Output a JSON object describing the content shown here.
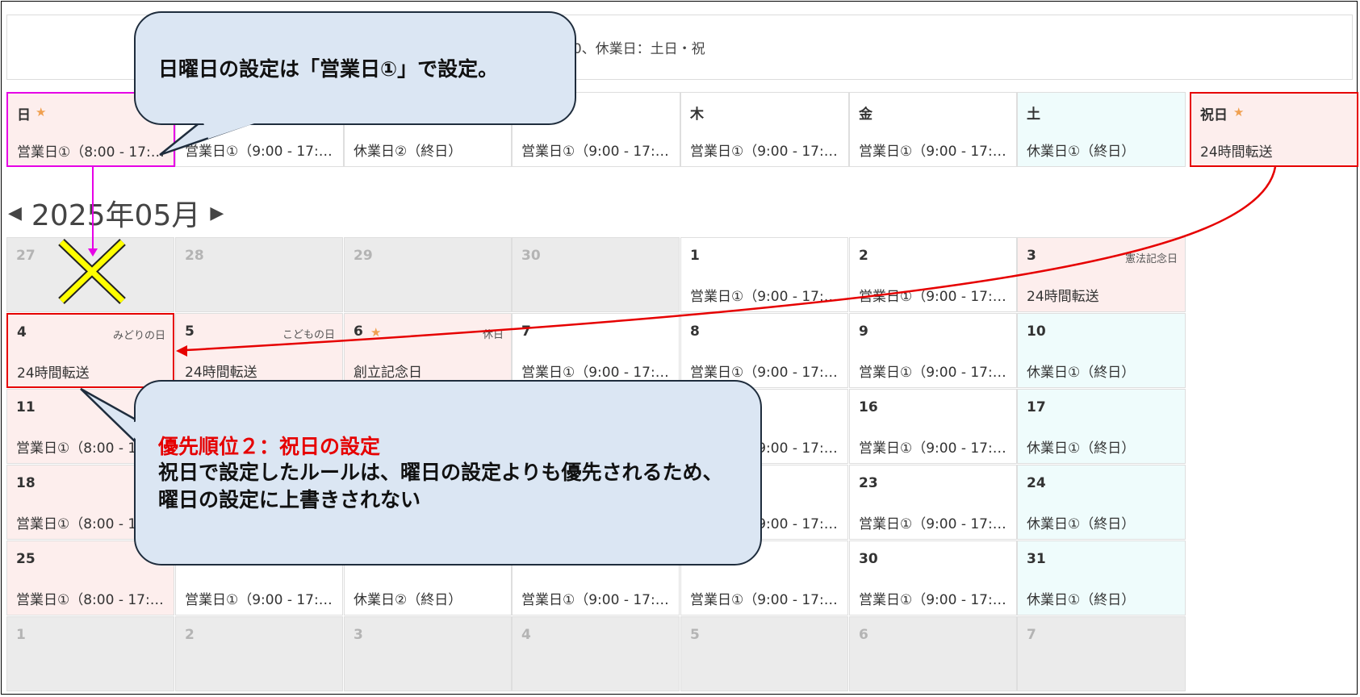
{
  "hours_bar": {
    "text": "00、休業日：土日・祝"
  },
  "weekday_rules": [
    {
      "day": "日",
      "star": true,
      "rule": "営業日①（8:00 - 17:00）",
      "style": "holiday-bg",
      "highlight": "hi-magenta"
    },
    {
      "day": "",
      "star": false,
      "rule": "営業日①（9:00 - 17:00）",
      "style": "",
      "highlight": ""
    },
    {
      "day": "",
      "star": false,
      "rule": "休業日②（終日）",
      "style": "",
      "highlight": ""
    },
    {
      "day": "",
      "star": false,
      "rule": "営業日①（9:00 - 17:00）",
      "style": "",
      "highlight": ""
    },
    {
      "day": "木",
      "star": false,
      "rule": "営業日①（9:00 - 17:00）",
      "style": "",
      "highlight": ""
    },
    {
      "day": "金",
      "star": false,
      "rule": "営業日①（9:00 - 17:00）",
      "style": "",
      "highlight": ""
    },
    {
      "day": "土",
      "star": false,
      "rule": "休業日①（終日）",
      "style": "sat-bg",
      "highlight": ""
    },
    {
      "day": "祝日",
      "star": true,
      "rule": "24時間転送",
      "style": "holiday-bg",
      "highlight": "hi-red"
    }
  ],
  "month_nav": {
    "title": "2025年05月",
    "prev_icon": "◀",
    "next_icon": "▶"
  },
  "calendar_weeks": [
    [
      {
        "day": "27",
        "holiday": "",
        "rule": "",
        "style": "other",
        "star": false
      },
      {
        "day": "28",
        "holiday": "",
        "rule": "",
        "style": "other",
        "star": false
      },
      {
        "day": "29",
        "holiday": "",
        "rule": "",
        "style": "other",
        "star": false
      },
      {
        "day": "30",
        "holiday": "",
        "rule": "",
        "style": "other",
        "star": false
      },
      {
        "day": "1",
        "holiday": "",
        "rule": "営業日①（9:00 - 17:00）",
        "style": "",
        "star": false
      },
      {
        "day": "2",
        "holiday": "",
        "rule": "営業日①（9:00 - 17:00）",
        "style": "",
        "star": false
      },
      {
        "day": "3",
        "holiday": "憲法記念日",
        "rule": "24時間転送",
        "style": "holiday-bg",
        "star": false
      }
    ],
    [
      {
        "day": "4",
        "holiday": "みどりの日",
        "rule": "24時間転送",
        "style": "holiday-bg hi-red",
        "star": false
      },
      {
        "day": "5",
        "holiday": "こどもの日",
        "rule": "24時間転送",
        "style": "holiday-bg",
        "star": false
      },
      {
        "day": "6",
        "holiday": "休日",
        "rule": "創立記念日",
        "style": "holiday-bg",
        "star": true
      },
      {
        "day": "7",
        "holiday": "",
        "rule": "営業日①（9:00 - 17:00）",
        "style": "",
        "star": false
      },
      {
        "day": "8",
        "holiday": "",
        "rule": "営業日①（9:00 - 17:00）",
        "style": "",
        "star": false
      },
      {
        "day": "9",
        "holiday": "",
        "rule": "営業日①（9:00 - 17:00）",
        "style": "",
        "star": false
      },
      {
        "day": "10",
        "holiday": "",
        "rule": "休業日①（終日）",
        "style": "sat-bg",
        "star": false
      }
    ],
    [
      {
        "day": "11",
        "holiday": "",
        "rule": "営業日①（8:00 - 17:00）",
        "style": "holiday-bg",
        "star": false
      },
      {
        "day": "",
        "holiday": "",
        "rule": "",
        "style": "",
        "star": false
      },
      {
        "day": "",
        "holiday": "",
        "rule": "",
        "style": "",
        "star": false
      },
      {
        "day": "",
        "holiday": "",
        "rule": "",
        "style": "",
        "star": false
      },
      {
        "day": "",
        "holiday": "",
        "rule": "営業日①（9:00 - 17:00）",
        "style": "",
        "star": false
      },
      {
        "day": "16",
        "holiday": "",
        "rule": "営業日①（9:00 - 17:00）",
        "style": "",
        "star": false
      },
      {
        "day": "17",
        "holiday": "",
        "rule": "休業日①（終日）",
        "style": "sat-bg",
        "star": false
      }
    ],
    [
      {
        "day": "18",
        "holiday": "",
        "rule": "営業日①（8:00 - 17:00）",
        "style": "holiday-bg",
        "star": false
      },
      {
        "day": "",
        "holiday": "",
        "rule": "",
        "style": "",
        "star": false
      },
      {
        "day": "",
        "holiday": "",
        "rule": "",
        "style": "",
        "star": false
      },
      {
        "day": "",
        "holiday": "",
        "rule": "",
        "style": "",
        "star": false
      },
      {
        "day": "",
        "holiday": "",
        "rule": "営業日①（9:00 - 17:00）",
        "style": "",
        "star": false
      },
      {
        "day": "23",
        "holiday": "",
        "rule": "営業日①（9:00 - 17:00）",
        "style": "",
        "star": false
      },
      {
        "day": "24",
        "holiday": "",
        "rule": "休業日①（終日）",
        "style": "sat-bg",
        "star": false
      }
    ],
    [
      {
        "day": "25",
        "holiday": "",
        "rule": "営業日①（8:00 - 17:00）",
        "style": "holiday-bg",
        "star": false
      },
      {
        "day": "",
        "holiday": "",
        "rule": "営業日①（9:00 - 17:00）",
        "style": "",
        "star": false
      },
      {
        "day": "",
        "holiday": "",
        "rule": "休業日②（終日）",
        "style": "",
        "star": false
      },
      {
        "day": "",
        "holiday": "",
        "rule": "営業日①（9:00 - 17:00）",
        "style": "",
        "star": false
      },
      {
        "day": "",
        "holiday": "",
        "rule": "営業日①（9:00 - 17:00）",
        "style": "",
        "star": false
      },
      {
        "day": "30",
        "holiday": "",
        "rule": "営業日①（9:00 - 17:00）",
        "style": "",
        "star": false
      },
      {
        "day": "31",
        "holiday": "",
        "rule": "休業日①（終日）",
        "style": "sat-bg",
        "star": false
      }
    ],
    [
      {
        "day": "1",
        "holiday": "",
        "rule": "",
        "style": "other",
        "star": false
      },
      {
        "day": "2",
        "holiday": "",
        "rule": "",
        "style": "other",
        "star": false
      },
      {
        "day": "3",
        "holiday": "",
        "rule": "",
        "style": "other",
        "star": false
      },
      {
        "day": "4",
        "holiday": "",
        "rule": "",
        "style": "other",
        "star": false
      },
      {
        "day": "5",
        "holiday": "",
        "rule": "",
        "style": "other",
        "star": false
      },
      {
        "day": "6",
        "holiday": "",
        "rule": "",
        "style": "other",
        "star": false
      },
      {
        "day": "7",
        "holiday": "",
        "rule": "",
        "style": "other",
        "star": false
      }
    ]
  ],
  "callout_top": {
    "text": "日曜日の設定は「営業日①」で設定。"
  },
  "callout_bottom": {
    "heading": "優先順位２：祝日の設定",
    "body": "祝日で設定したルールは、曜日の設定よりも優先されるため、曜日の設定に上書きされない"
  },
  "colors": {
    "magenta": "#e600e6",
    "red": "#e60000",
    "callout_bg": "#dbe6f3",
    "star": "#f0a050",
    "cross": "#ffff00"
  }
}
